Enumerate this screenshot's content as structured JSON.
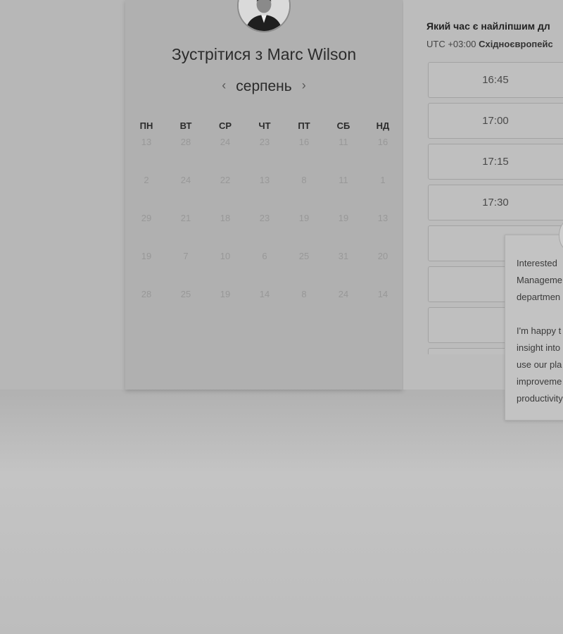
{
  "header": {
    "meet_prefix": "Зустрітися з",
    "host_name": "Marc Wilson"
  },
  "calendar": {
    "month": "серпень",
    "prev_icon": "‹",
    "next_icon": "›",
    "weekdays": [
      "ПН",
      "ВТ",
      "СР",
      "ЧТ",
      "ПТ",
      "СБ",
      "НД"
    ],
    "weeks": [
      [
        "13",
        "28",
        "24",
        "23",
        "16",
        "11",
        "16"
      ],
      [
        "2",
        "24",
        "22",
        "13",
        "8",
        "11",
        "1"
      ],
      [
        "29",
        "21",
        "18",
        "23",
        "19",
        "19",
        "13"
      ],
      [
        "19",
        "7",
        "10",
        "6",
        "25",
        "31",
        "20"
      ],
      [
        "28",
        "25",
        "19",
        "14",
        "8",
        "24",
        "14"
      ]
    ]
  },
  "scheduler": {
    "question": "Який час є найліпшим дл",
    "tz_prefix": "UTC +03:00",
    "tz_name": "Східноєвропейс",
    "slots": [
      "16:45",
      "17:00",
      "17:15",
      "17:30",
      "",
      "",
      "",
      ""
    ]
  },
  "popup": {
    "lines_1": [
      "Interested",
      "Manageme",
      "departmen"
    ],
    "lines_2": [
      "I'm happy t",
      "insight into",
      "use our pla",
      "improveme",
      "productivity"
    ]
  },
  "icons": {
    "prev": "chevron-left-icon",
    "next": "chevron-right-icon",
    "avatar": "person-photo"
  }
}
